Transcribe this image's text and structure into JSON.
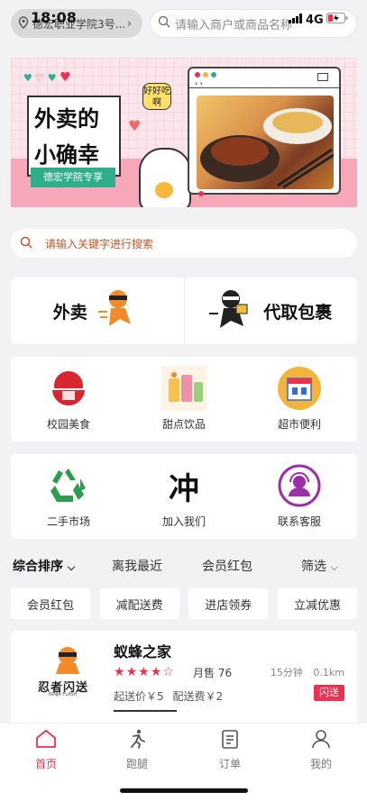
{
  "status": {
    "time": "18:08",
    "network": "4G"
  },
  "location": {
    "text": "德宏职业学院3号..."
  },
  "top_search": {
    "placeholder": "请输入商户或商品名称"
  },
  "banner": {
    "title_line1": "外卖的",
    "title_line2": "小确幸",
    "subtitle": "德宏学院专享",
    "bubble": "好好吃啊",
    "accent": "#f7a8b8",
    "tag_color": "#2fae8b"
  },
  "search": {
    "placeholder": "请输入关键字进行搜索"
  },
  "services": [
    {
      "label": "外卖",
      "icon": "ninja-runner-icon"
    },
    {
      "label": "代取包裹",
      "icon": "ninja-parcel-icon"
    }
  ],
  "categories_row1": [
    {
      "label": "校园美食",
      "icon": "food-bowl-icon"
    },
    {
      "label": "甜点饮品",
      "icon": "drinks-icon"
    },
    {
      "label": "超市便利",
      "icon": "supermarket-icon"
    }
  ],
  "categories_row2": [
    {
      "label": "二手市场",
      "icon": "recycle-icon"
    },
    {
      "label": "加入我们",
      "icon": "join-calligraphy-icon",
      "glyph": "冲"
    },
    {
      "label": "联系客服",
      "icon": "customer-service-icon"
    }
  ],
  "sort": {
    "overall": "综合排序",
    "nearest": "离我最近",
    "member": "会员红包",
    "filter": "筛选"
  },
  "chips": [
    "会员红包",
    "减配送费",
    "进店领券",
    "立减优惠"
  ],
  "shop": {
    "name": "蚁蜂之家",
    "rating": 4,
    "monthly_sales": "月售 76",
    "delivery_time": "15分钟",
    "distance": "0.1km",
    "min_order": "起送价￥5",
    "delivery_fee": "配送费￥2",
    "flash_badge": "闪送",
    "logo_text": "忍者闪送",
    "logo_sub": "NINJA FLASH"
  },
  "tabs": [
    {
      "label": "首页",
      "icon": "home-icon",
      "active": true
    },
    {
      "label": "跑腿",
      "icon": "runner-icon",
      "active": false
    },
    {
      "label": "订单",
      "icon": "order-icon",
      "active": false
    },
    {
      "label": "我的",
      "icon": "user-icon",
      "active": false
    }
  ],
  "colors": {
    "brand": "#e8324f",
    "search_text": "#c0552a"
  }
}
